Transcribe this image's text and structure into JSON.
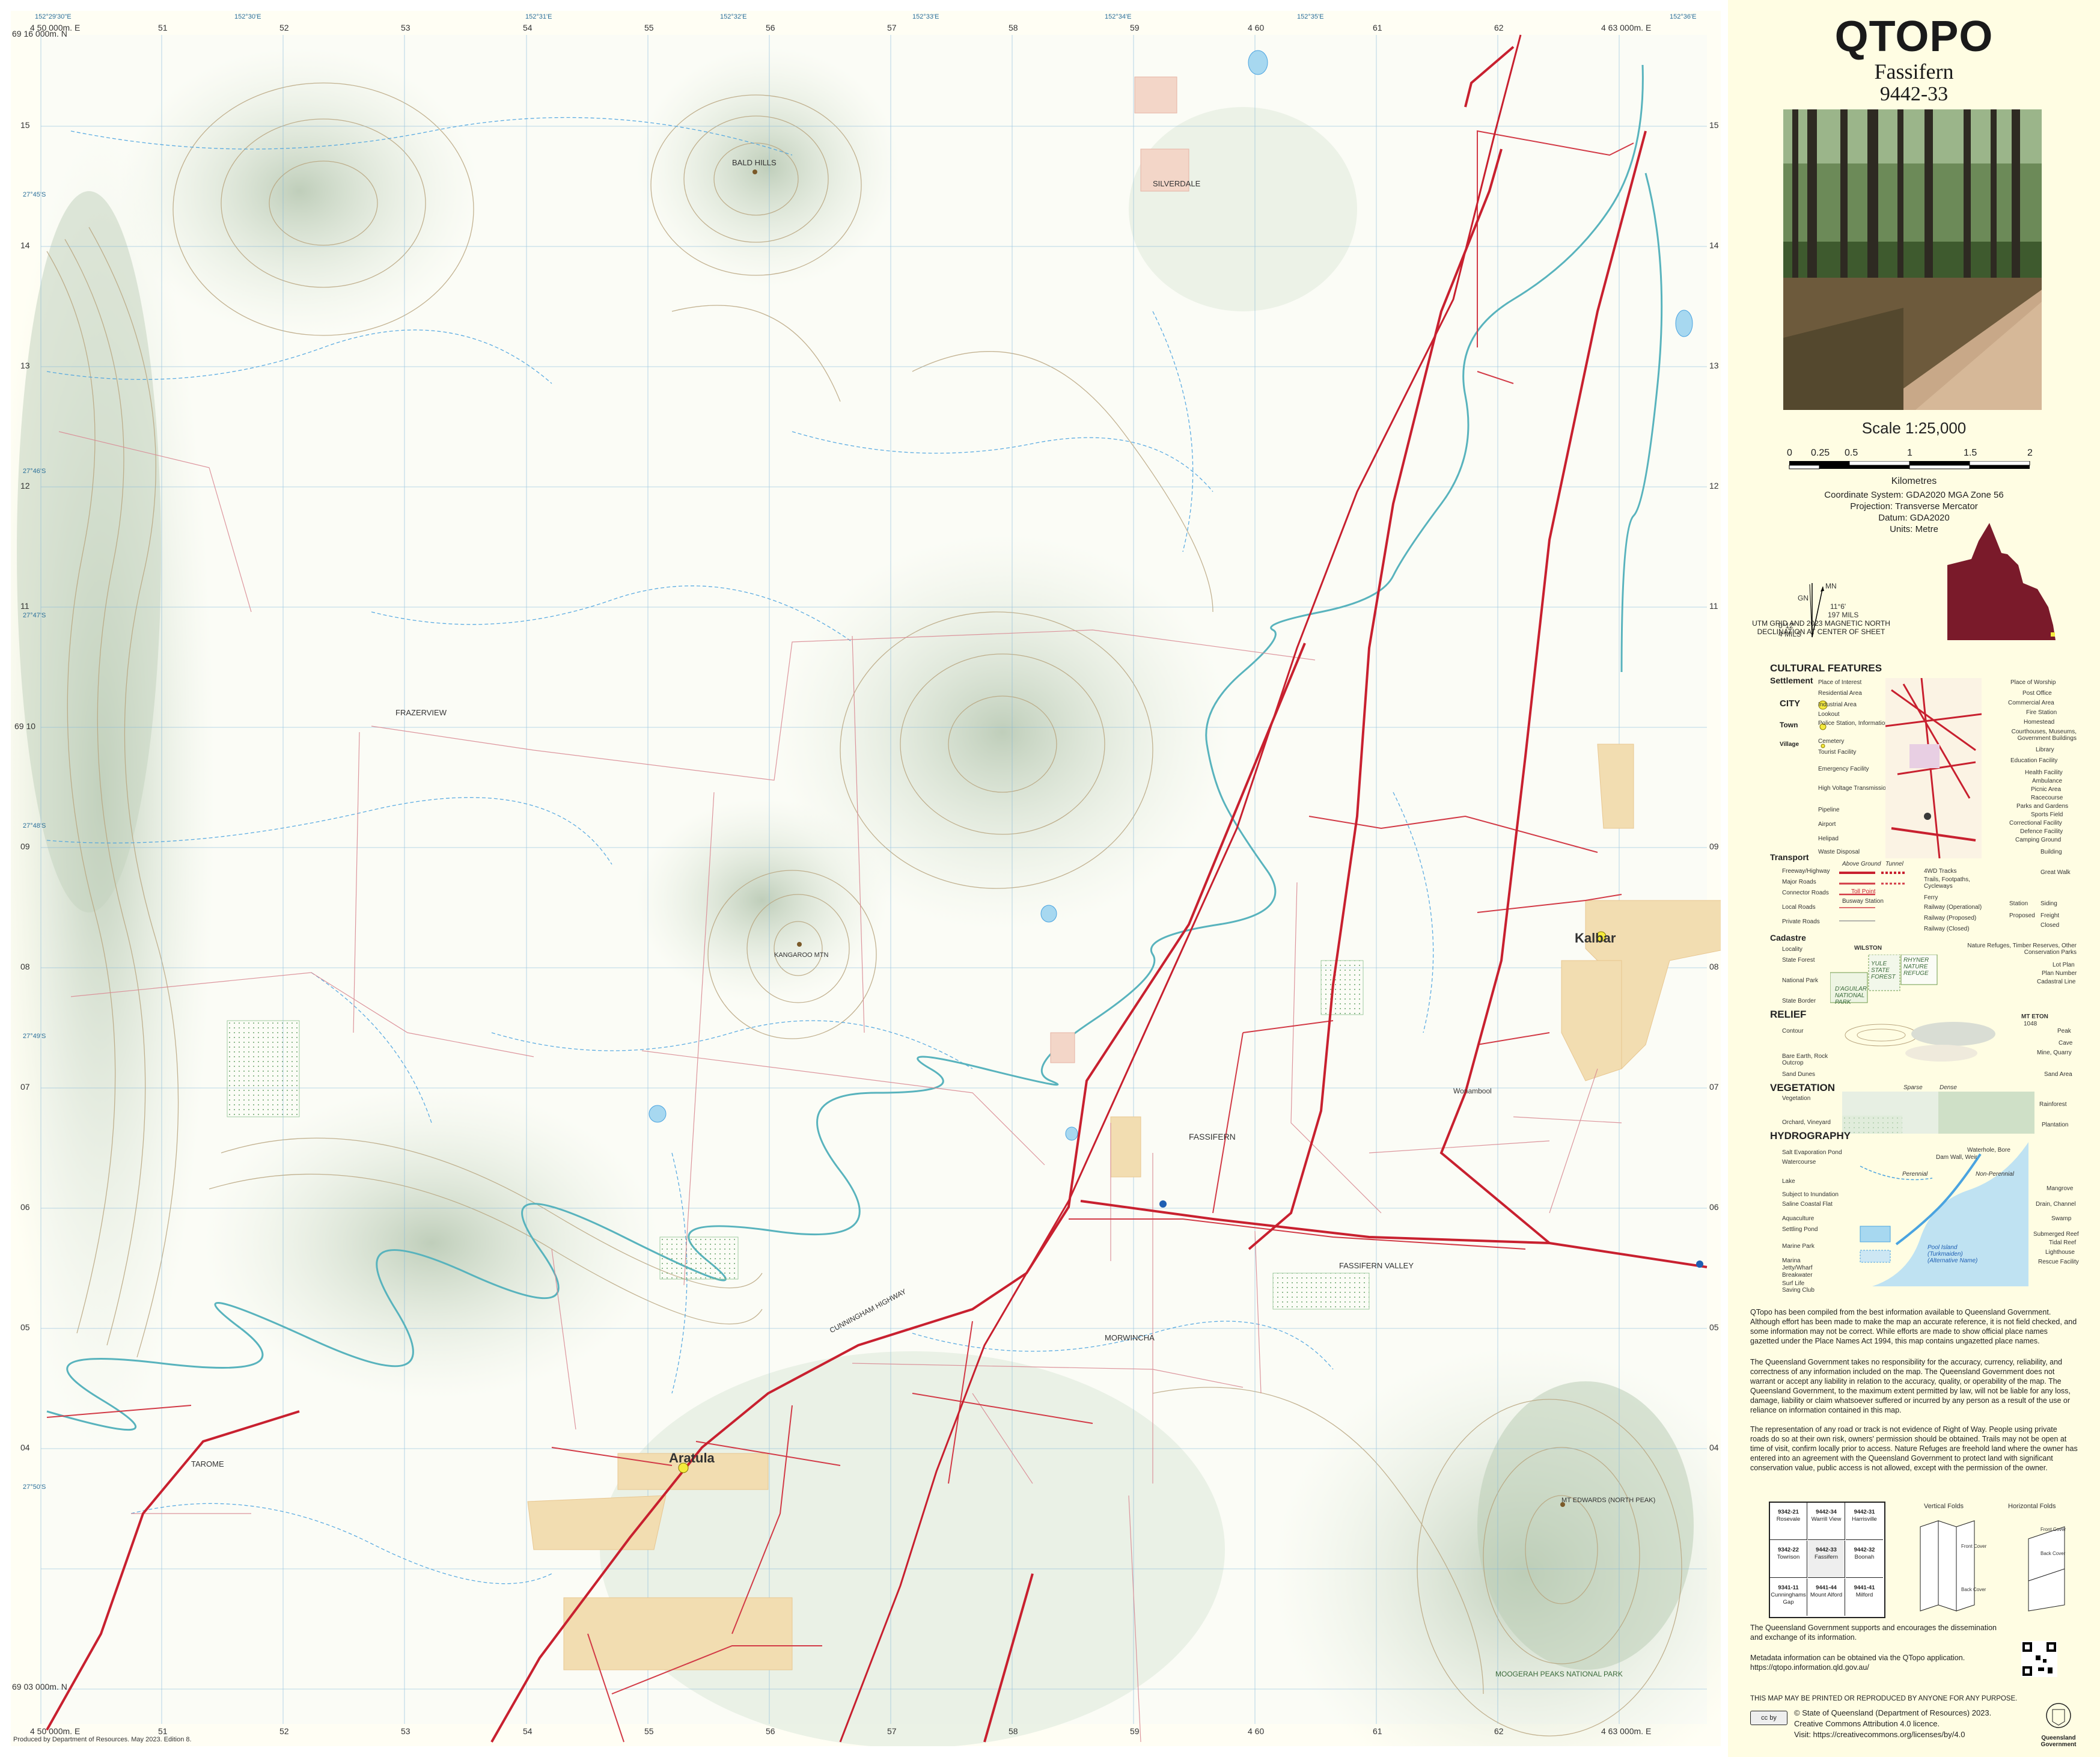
{
  "map": {
    "top_eastings": [
      "4 50 000m. E",
      "51",
      "52",
      "53",
      "54",
      "55",
      "56",
      "57",
      "58",
      "59",
      "4 60",
      "61",
      "62",
      "4 63 000m. E"
    ],
    "bottom_eastings": [
      "4 50 000m. E",
      "51",
      "52",
      "53",
      "54",
      "55",
      "56",
      "57",
      "58",
      "59",
      "4 60",
      "61",
      "62",
      "4 63 000m. E"
    ],
    "top_degrees": [
      "152°29'30\"E",
      "152°30'E",
      "152°31'E",
      "152°32'E",
      "152°33'E",
      "152°34'E",
      "152°35'E",
      "152°36'E"
    ],
    "left_northings": [
      "69 16 000m. N",
      "15",
      "14",
      "13",
      "12",
      "11",
      "69 10",
      "09",
      "08",
      "07",
      "06",
      "05",
      "04",
      "69 03 000m. N"
    ],
    "right_northings": [
      "69 16 000m. N",
      "15",
      "14",
      "13",
      "12",
      "11",
      "69 10",
      "09",
      "08",
      "07",
      "06",
      "05",
      "04",
      "69 03 000m. N"
    ],
    "side_degrees": [
      "27°45'S",
      "27°46'S",
      "27°47'S",
      "27°48'S",
      "27°49'S",
      "27°50'S"
    ],
    "places": {
      "bald_hills": "BALD HILLS",
      "silverdale": "SILVERDALE",
      "frazerview": "FRAZERVIEW",
      "kangaroo_mtn": "KANGAROO MTN",
      "kalbar": "Kalbar",
      "fassifern": "FASSIFERN",
      "fassifern_valley": "FASSIFERN VALLEY",
      "morwincha": "MORWINCHA",
      "aratula": "Aratula",
      "tarome": "TAROME",
      "mt_edwards": "MT EDWARDS (NORTH PEAK)",
      "moogerah": "MOOGERAH PEAKS NATIONAL PARK",
      "cunningham_hwy": "CUNNINGHAM HIGHWAY",
      "wonambool": "Wonambool"
    },
    "produced": "Produced by Department of Resources. May 2023. Edition 8."
  },
  "panel": {
    "title": "QTOPO",
    "sheet_name": "Fassifern",
    "sheet_number": "9442-33",
    "scale": "Scale 1:25,000",
    "scale_ticks": [
      "0",
      "0.25",
      "0.5",
      "1",
      "1.5",
      "2"
    ],
    "scale_unit": "Kilometres",
    "coordinate_system": "Coordinate System: GDA2020 MGA Zone 56",
    "projection": "Projection: Transverse Mercator",
    "datum": "Datum: GDA2020",
    "units": "Units: Metre",
    "declination": {
      "mn": "MN",
      "gn": "GN",
      "mn_angle": "11°6'",
      "mn_mils": "197 MILS",
      "gn_angle": "0°12'",
      "gn_mils": "4 MILS",
      "caption": "UTM GRID AND 2023 MAGNETIC NORTH DECLINATION AT CENTER OF SHEET"
    },
    "legend": {
      "cultural_features": "CULTURAL FEATURES",
      "settlement": "Settlement",
      "city": "CITY",
      "town": "Town",
      "village": "Village",
      "left_items": [
        "Place of Interest",
        "Residential Area",
        "Industrial Area",
        "Lookout",
        "Police Station, Information Centre",
        "Cemetery",
        "Tourist Facility",
        "Emergency Facility",
        "High Voltage Transmission",
        "Pipeline",
        "Airport",
        "Helipad",
        "Waste Disposal"
      ],
      "right_items": [
        "Place of Worship",
        "Post Office",
        "Commercial Area",
        "Fire Station",
        "Homestead",
        "Courthouses, Museums, Government Buildings",
        "Library",
        "Education Facility",
        "Health Facility",
        "Ambulance",
        "Picnic Area",
        "Racecourse",
        "Parks and Gardens",
        "Sports Field",
        "Correctional Facility",
        "Defence Facility",
        "Camping Ground",
        "Building"
      ],
      "transport": "Transport",
      "transport_head": [
        "Above Ground",
        "Tunnel"
      ],
      "transport_items": [
        "Freeway/Highway",
        "Major Roads",
        "Connector Roads",
        "Local Roads",
        "Private Roads"
      ],
      "transport_right": [
        "4WD Tracks",
        "Trails, Footpaths, Cycleways",
        "Ferry",
        "Railway (Operational)",
        "Railway (Proposed)",
        "Railway (Closed)"
      ],
      "transport_mid": [
        "Great Walk",
        "Toll Point",
        "Busway Station",
        "Station",
        "Siding",
        "Proposed",
        "Freight",
        "Closed"
      ],
      "cadastre": "Cadastre",
      "cadastre_items": [
        "Locality",
        "State Forest",
        "National Park",
        "State Border"
      ],
      "cadastre_right": [
        "Nature Refuges, Timber Reserves, Other Conservation Parks",
        "Lot Plan",
        "Plan Number",
        "Cadastral Line"
      ],
      "cadastre_samples": [
        "WILSTON",
        "YULE STATE FOREST",
        "RHYNER NATURE REFUGE",
        "D'AGUILAR NATIONAL PARK"
      ],
      "relief": "RELIEF",
      "relief_items": [
        "Contour",
        "Bare Earth, Rock Outcrop",
        "Sand Dunes"
      ],
      "relief_right": [
        "Peak",
        "Cave",
        "Mine, Quarry",
        "Sand Area"
      ],
      "relief_samples": [
        "MT ETON",
        "1048"
      ],
      "vegetation": "VEGETATION",
      "vegetation_items": [
        "Vegetation",
        "Orchard, Vineyard"
      ],
      "vegetation_right": [
        "Rainforest",
        "Plantation"
      ],
      "vegetation_samples": [
        "Sparse",
        "Dense"
      ],
      "hydrography": "HYDROGRAPHY",
      "hydro_items": [
        "Salt Evaporation Pond",
        "Watercourse",
        "Lake",
        "Subject to Inundation",
        "Saline Coastal Flat",
        "Aquaculture",
        "Settling Pond",
        "Marine Park",
        "Marina",
        "Jetty/Wharf",
        "Breakwater",
        "Surf Life Saving Club"
      ],
      "hydro_right": [
        "Waterhole, Bore",
        "Dam Wall, Weir",
        "Mangrove",
        "Drain, Channel",
        "Swamp",
        "Submerged Reef",
        "Tidal Reef",
        "Lighthouse",
        "Rescue Facility"
      ],
      "hydro_samples": [
        "Perennial",
        "Non-Perennial",
        "Pool Island (Turkmaiden) (Alternative Name)"
      ]
    },
    "para1": "QTopo has been compiled from the best information available to Queensland Government. Although effort has been made to make the map an accurate reference, it is not field checked, and some information may not be correct. While efforts are made to show official place names gazetted under the Place Names Act 1994, this map contains ungazetted place names.",
    "para2": "The Queensland Government takes no responsibility for the accuracy, currency, reliability, and correctness of any information included on the map. The Queensland Government does not warrant or accept any liability in relation to the accuracy, quality, or operability of the map. The Queensland Government, to the maximum extent permitted by law, will not be liable for any loss, damage, liability or claim whatsoever suffered or incurred by any person as a result of the use or reliance on information contained in this map.",
    "para3": "The representation of any road or track is not evidence of Right of Way. People using private roads do so at their own risk, owners' permission should be obtained. Trails may not be open at time of visit, confirm locally prior to access. Nature Refuges are freehold land where the owner has entered into an agreement with the Queensland Government to protect land with significant conservation value, public access is not allowed, except with the permission of the owner.",
    "adjoining": [
      [
        "9342-21",
        "Rosevale",
        "9442-34",
        "Warrill View",
        "9442-31",
        "Harrisville"
      ],
      [
        "9342-22",
        "Towrison",
        "9442-33",
        "Fassifern",
        "9442-32",
        "Boonah"
      ],
      [
        "9341-11",
        "Cunninghams Gap",
        "9441-44",
        "Mount Alford",
        "9441-41",
        "Milford"
      ]
    ],
    "folds": [
      "Vertical Folds",
      "Horizontal Folds"
    ],
    "fold_labels": [
      "Front Cover",
      "Back Cover",
      "Back Cover",
      "Front Cover"
    ],
    "para4": "The Queensland Government supports and encourages the dissemination and exchange of its information.",
    "para5": "Metadata information can be obtained via the QTopo application. https://qtopo.information.qld.gov.au/",
    "print_notice": "THIS MAP MAY BE PRINTED OR REPRODUCED BY ANYONE FOR ANY PURPOSE.",
    "copyright": "© State of Queensland (Department of Resources) 2023.",
    "licence": "Creative Commons Attribution 4.0 licence.",
    "licence_url": "Visit: https://creativecommons.org/licenses/by/4.0",
    "gov_name": "Queensland Government",
    "cc_badge": "cc by"
  },
  "colors": {
    "highway": "#c8202f",
    "road": "#d23a46",
    "cadastre": "#d97a85",
    "contour": "#b7a07a",
    "water": "#3a9ad9",
    "river": "#4fb5c0",
    "vegetation": "#e7efe3",
    "qld": "#7a1a2a",
    "panel": "#fffde3"
  }
}
